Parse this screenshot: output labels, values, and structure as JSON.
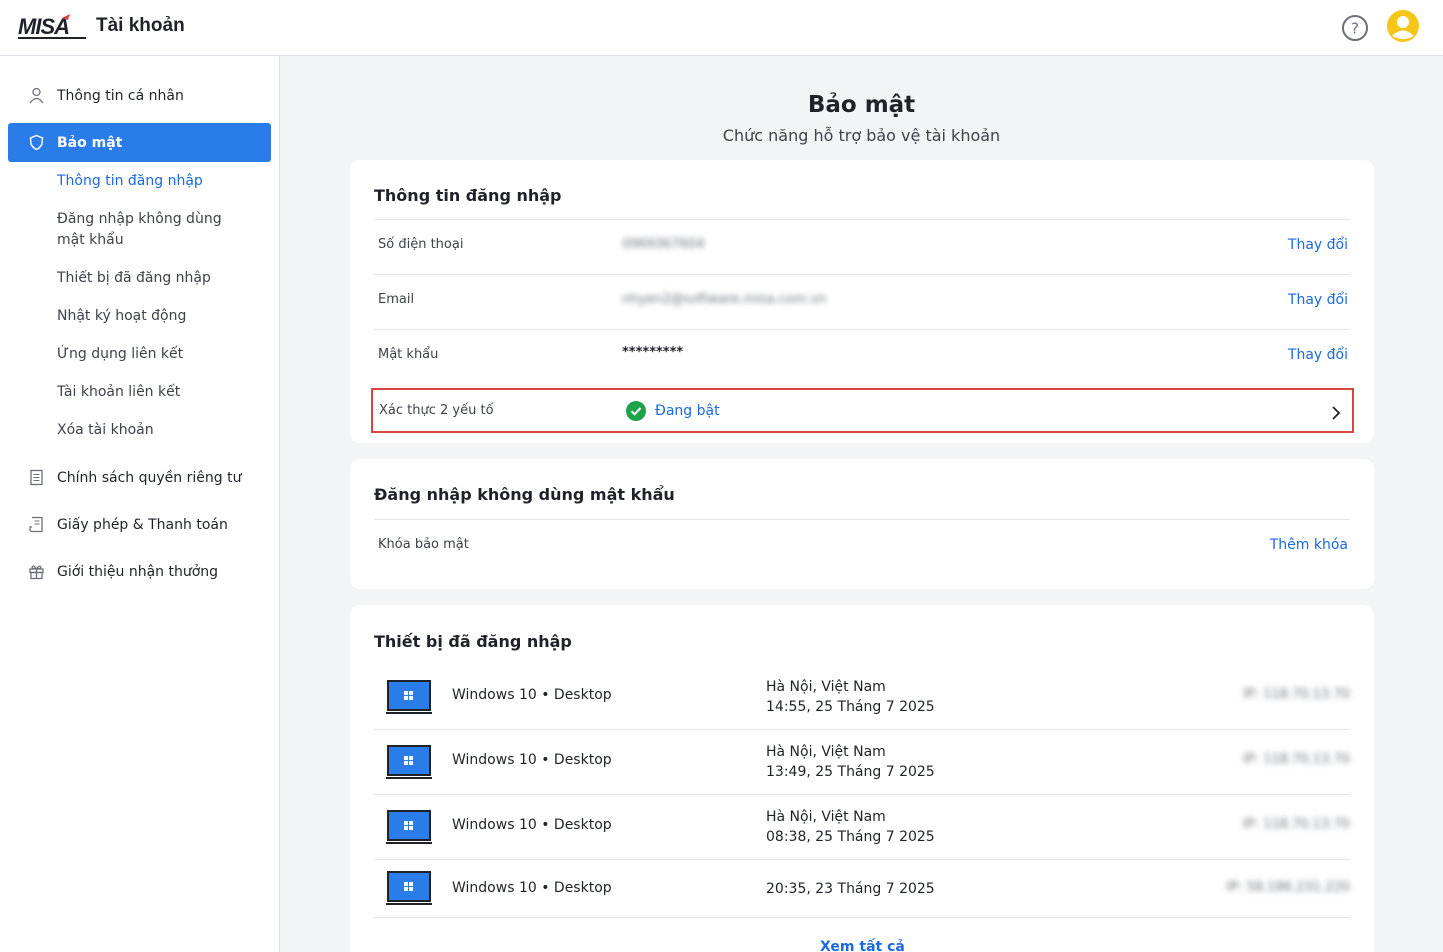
{
  "header": {
    "logo_text": "MISA",
    "app_title": "Tài khoản"
  },
  "sidebar": {
    "items": [
      {
        "label": "Thông tin cá nhân",
        "icon": "user-icon"
      },
      {
        "label": "Bảo mật",
        "icon": "shield-icon"
      },
      {
        "label": "Chính sách quyền riêng tư",
        "icon": "document-icon"
      },
      {
        "label": "Giấy phép & Thanh toán",
        "icon": "receipt-icon"
      },
      {
        "label": "Giới thiệu nhận thưởng",
        "icon": "gift-icon"
      }
    ],
    "sub_items": [
      "Thông tin đăng nhập",
      "Đăng nhập không dùng mật khẩu",
      "Thiết bị đã đăng nhập",
      "Nhật ký hoạt động",
      "Ứng dụng liên kết",
      "Tài khoản liên kết",
      "Xóa tài khoản"
    ]
  },
  "main": {
    "title": "Bảo mật",
    "subtitle": "Chức năng hỗ trợ bảo vệ tài khoản",
    "login_info": {
      "title": "Thông tin đăng nhập",
      "rows": [
        {
          "label": "Số điện thoại",
          "value": "0969367604",
          "action": "Thay đổi"
        },
        {
          "label": "Email",
          "value": "nhyen2@software.misa.com.vn",
          "action": "Thay đổi"
        },
        {
          "label": "Mật khẩu",
          "value": "*********",
          "action": "Thay đổi"
        }
      ],
      "two_factor": {
        "label": "Xác thực 2 yếu tố",
        "status": "Đang bật"
      }
    },
    "passwordless": {
      "title": "Đăng nhập không dùng mật khẩu",
      "row_label": "Khóa bảo mật",
      "action": "Thêm khóa"
    },
    "devices": {
      "title": "Thiết bị đã đăng nhập",
      "rows": [
        {
          "os": "Windows 10 • Desktop",
          "location": "Hà Nội, Việt Nam",
          "time": "14:55, 25 Tháng 7 2025",
          "ip": "IP: 118.70.13.70"
        },
        {
          "os": "Windows 10 • Desktop",
          "location": "Hà Nội, Việt Nam",
          "time": "13:49, 25 Tháng 7 2025",
          "ip": "IP: 118.70.13.70"
        },
        {
          "os": "Windows 10 • Desktop",
          "location": "Hà Nội, Việt Nam",
          "time": "08:38, 25 Tháng 7 2025",
          "ip": "IP: 118.70.13.70"
        },
        {
          "os": "Windows 10 • Desktop",
          "location": "",
          "time": "20:35, 23 Tháng 7 2025",
          "ip": "IP: 58.186.231.220"
        }
      ],
      "see_all": "Xem tất cả"
    }
  },
  "colors": {
    "accent": "#2a7de9",
    "link": "#1b6ae0",
    "highlight": "#d9463f",
    "success": "#1fa34a",
    "avatar": "#f5c518"
  }
}
